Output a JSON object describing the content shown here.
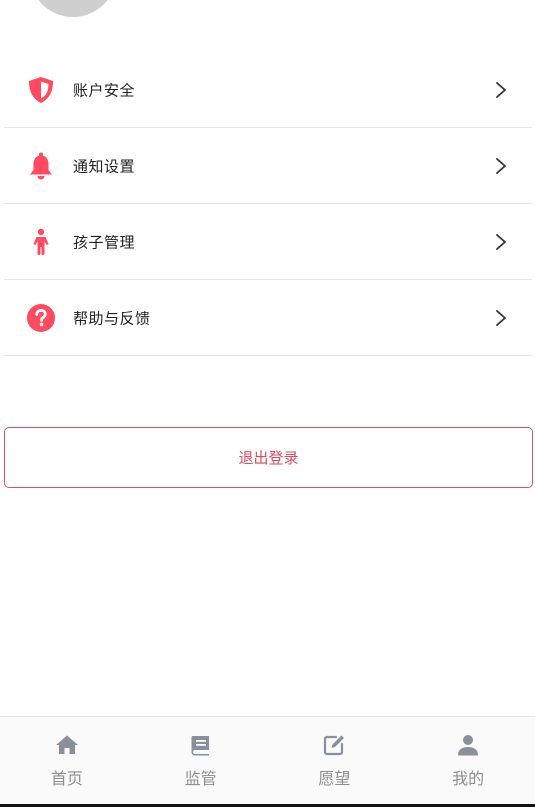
{
  "menu": {
    "items": [
      {
        "label": "账户安全",
        "icon": "shield-icon"
      },
      {
        "label": "通知设置",
        "icon": "bell-icon"
      },
      {
        "label": "孩子管理",
        "icon": "child-icon"
      },
      {
        "label": "帮助与反馈",
        "icon": "question-icon"
      }
    ]
  },
  "logout": {
    "label": "退出登录"
  },
  "tabbar": {
    "tabs": [
      {
        "label": "首页",
        "icon": "home-icon"
      },
      {
        "label": "监管",
        "icon": "book-icon"
      },
      {
        "label": "愿望",
        "icon": "edit-icon"
      },
      {
        "label": "我的",
        "icon": "user-icon"
      }
    ]
  },
  "colors": {
    "accent": "#ff4a60",
    "logout_text": "#e04a5e",
    "tab_icon": "#8a909b",
    "tab_label": "#8e8e8e"
  }
}
